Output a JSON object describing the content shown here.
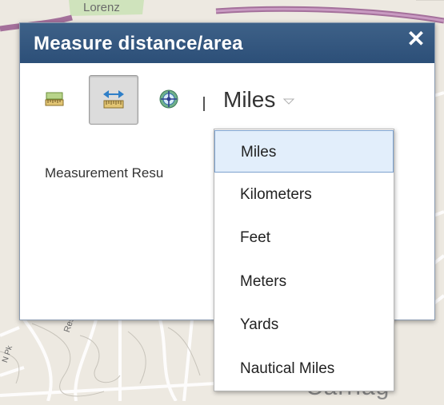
{
  "map": {
    "labels": {
      "lorenz": "Lorenz",
      "carriage": "Carriag",
      "reserve": "Reserve Pk",
      "edge": "N Pk"
    }
  },
  "dialog": {
    "title": "Measure distance/area",
    "close_label": "✕",
    "tools": {
      "area_icon": "area-measure-icon",
      "distance_icon": "distance-measure-icon",
      "location_icon": "location-icon",
      "active": "distance"
    },
    "unit_select": {
      "value": "Miles"
    },
    "result_label": "Measurement Resu"
  },
  "unit_menu": {
    "items": [
      "Miles",
      "Kilometers",
      "Feet",
      "Meters",
      "Yards",
      "Nautical Miles"
    ],
    "selected": "Miles"
  },
  "colors": {
    "titlebar": "#2c4f78",
    "selection": "#e2eefb",
    "map_road": "#a4709b"
  }
}
